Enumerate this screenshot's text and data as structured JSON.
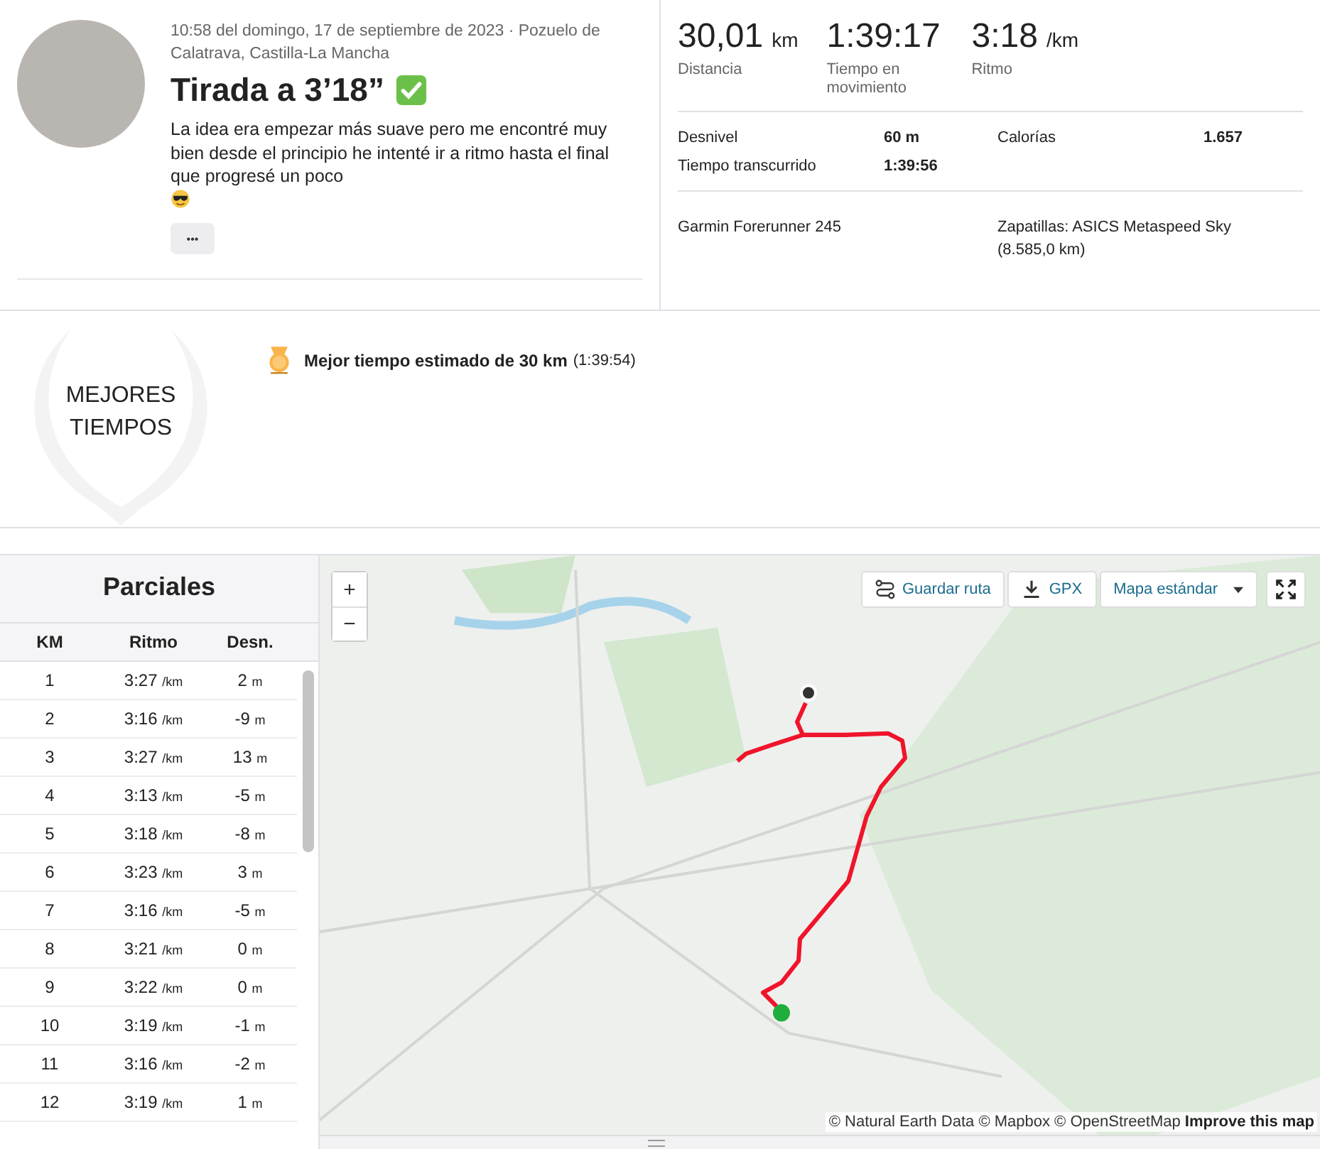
{
  "activity": {
    "meta": "10:58 del domingo, 17 de septiembre de 2023 · Pozuelo de Calatrava, Castilla-La Mancha",
    "title": "Tirada a 3’18”",
    "description": "La idea era empezar más suave pero me encontré muy bien desde el principio he intenté ir a ritmo hasta el final que progresé un poco",
    "more_button": "•••"
  },
  "primary_stats": [
    {
      "value": "30,01",
      "unit": "km",
      "label": "Distancia"
    },
    {
      "value": "1:39:17",
      "label": "Tiempo en movimiento"
    },
    {
      "value": "3:18",
      "unit": "/km",
      "label": "Ritmo"
    }
  ],
  "secondary_stats": [
    {
      "label": "Desnivel",
      "value": "60 m"
    },
    {
      "label": "Calorías",
      "value": "1.657"
    },
    {
      "label": "Tiempo transcurrido",
      "value": "1:39:56"
    }
  ],
  "device": "Garmin Forerunner 245",
  "shoes": "Zapatillas: ASICS Metaspeed Sky (8.585,0 km)",
  "best_efforts": {
    "badge": "MEJORES TIEMPOS",
    "items": [
      {
        "title": "Mejor tiempo estimado de 30 km",
        "time": "(1:39:54)"
      }
    ]
  },
  "splits": {
    "title": "Parciales",
    "columns": [
      "KM",
      "Ritmo",
      "Desn."
    ],
    "rows": [
      {
        "km": "1",
        "pace": "3:27",
        "pace_unit": "/km",
        "elev": "2",
        "elev_unit": "m"
      },
      {
        "km": "2",
        "pace": "3:16",
        "pace_unit": "/km",
        "elev": "-9",
        "elev_unit": "m"
      },
      {
        "km": "3",
        "pace": "3:27",
        "pace_unit": "/km",
        "elev": "13",
        "elev_unit": "m"
      },
      {
        "km": "4",
        "pace": "3:13",
        "pace_unit": "/km",
        "elev": "-5",
        "elev_unit": "m"
      },
      {
        "km": "5",
        "pace": "3:18",
        "pace_unit": "/km",
        "elev": "-8",
        "elev_unit": "m"
      },
      {
        "km": "6",
        "pace": "3:23",
        "pace_unit": "/km",
        "elev": "3",
        "elev_unit": "m"
      },
      {
        "km": "7",
        "pace": "3:16",
        "pace_unit": "/km",
        "elev": "-5",
        "elev_unit": "m"
      },
      {
        "km": "8",
        "pace": "3:21",
        "pace_unit": "/km",
        "elev": "0",
        "elev_unit": "m"
      },
      {
        "km": "9",
        "pace": "3:22",
        "pace_unit": "/km",
        "elev": "0",
        "elev_unit": "m"
      },
      {
        "km": "10",
        "pace": "3:19",
        "pace_unit": "/km",
        "elev": "-1",
        "elev_unit": "m"
      },
      {
        "km": "11",
        "pace": "3:16",
        "pace_unit": "/km",
        "elev": "-2",
        "elev_unit": "m"
      },
      {
        "km": "12",
        "pace": "3:19",
        "pace_unit": "/km",
        "elev": "1",
        "elev_unit": "m"
      }
    ]
  },
  "map": {
    "zoom_in": "+",
    "zoom_out": "−",
    "save_route": "Guardar ruta",
    "gpx": "GPX",
    "style": "Mapa estándar",
    "attribution": "© Natural Earth Data © Mapbox © OpenStreetMap",
    "improve_link": "Improve this map"
  }
}
